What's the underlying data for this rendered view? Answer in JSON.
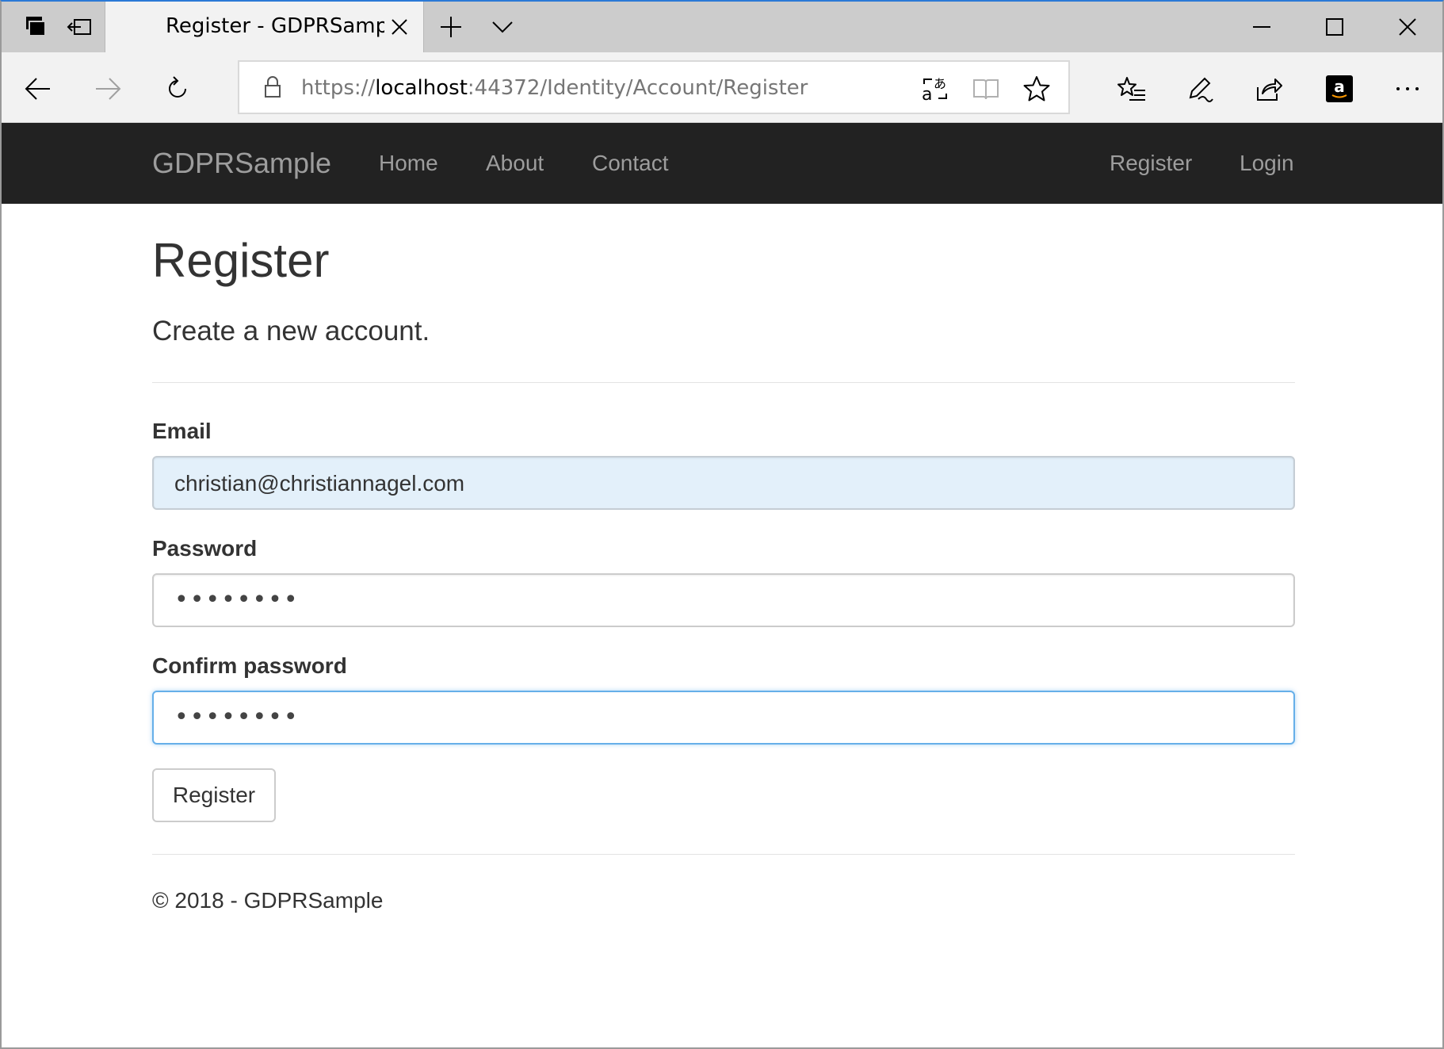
{
  "browser": {
    "tab": {
      "title": "Register - GDPRSample"
    },
    "address": {
      "scheme": "https://",
      "host": "localhost",
      "rest": ":44372/Identity/Account/Register"
    },
    "colors": {
      "accent": "#2b79d6",
      "amazon": "#000000"
    }
  },
  "navbar": {
    "brand": "GDPRSample",
    "links": [
      "Home",
      "About",
      "Contact"
    ],
    "right_links": [
      "Register",
      "Login"
    ],
    "background": "#222222"
  },
  "page": {
    "title": "Register",
    "subtitle": "Create a new account.",
    "email": {
      "label": "Email",
      "value": "christian@christiannagel.com"
    },
    "password": {
      "label": "Password",
      "masked": "••••••••"
    },
    "confirm": {
      "label": "Confirm password",
      "masked": "••••••••"
    },
    "submit_label": "Register",
    "footer": "© 2018 - GDPRSample"
  }
}
